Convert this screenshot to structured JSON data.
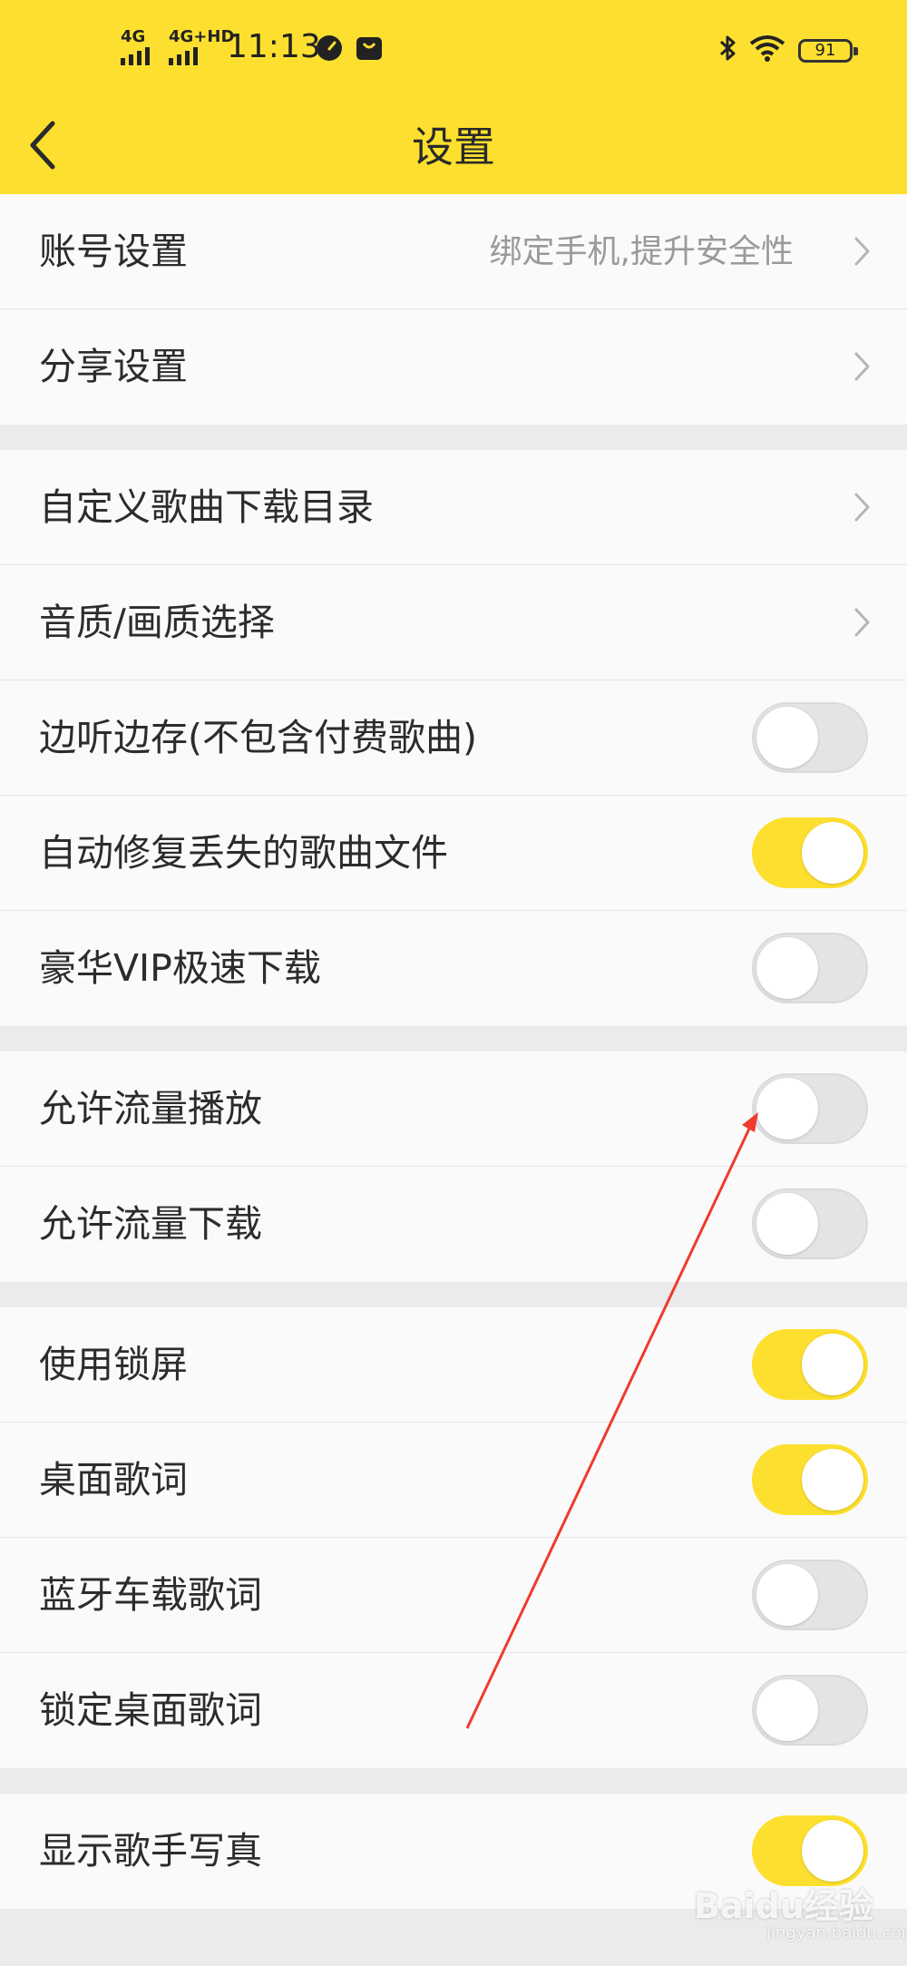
{
  "status_bar": {
    "signal_1": "4G",
    "signal_2": "4G+HD",
    "time": "11:13",
    "battery": "91",
    "icons": [
      "speedometer-icon",
      "notification-bag-icon",
      "bluetooth-icon",
      "wifi-icon",
      "battery-icon"
    ]
  },
  "nav": {
    "title": "设置",
    "back_icon": "chevron-left-icon"
  },
  "colors": {
    "accent": "#fde02f",
    "background": "#ebebeb",
    "row": "#fafafa",
    "annotation_arrow": "#f03a2e"
  },
  "groups": [
    {
      "rows": [
        {
          "label": "账号设置",
          "hint": "绑定手机,提升安全性",
          "type": "link"
        },
        {
          "label": "分享设置",
          "type": "link"
        }
      ]
    },
    {
      "rows": [
        {
          "label": "自定义歌曲下载目录",
          "type": "link"
        },
        {
          "label": "音质/画质选择",
          "type": "link"
        },
        {
          "label": "边听边存(不包含付费歌曲)",
          "type": "toggle",
          "on": false
        },
        {
          "label": "自动修复丢失的歌曲文件",
          "type": "toggle",
          "on": true
        },
        {
          "label": "豪华VIP极速下载",
          "type": "toggle",
          "on": false
        }
      ]
    },
    {
      "rows": [
        {
          "label": "允许流量播放",
          "type": "toggle",
          "on": false
        },
        {
          "label": "允许流量下载",
          "type": "toggle",
          "on": false
        }
      ]
    },
    {
      "rows": [
        {
          "label": "使用锁屏",
          "type": "toggle",
          "on": true
        },
        {
          "label": "桌面歌词",
          "type": "toggle",
          "on": true
        },
        {
          "label": "蓝牙车载歌词",
          "type": "toggle",
          "on": false
        },
        {
          "label": "锁定桌面歌词",
          "type": "toggle",
          "on": false
        }
      ]
    },
    {
      "rows": [
        {
          "label": "显示歌手写真",
          "type": "toggle",
          "on": true
        }
      ]
    }
  ],
  "watermark": {
    "text": "Baidu经验",
    "sub": "jingyan.baidu.com"
  }
}
